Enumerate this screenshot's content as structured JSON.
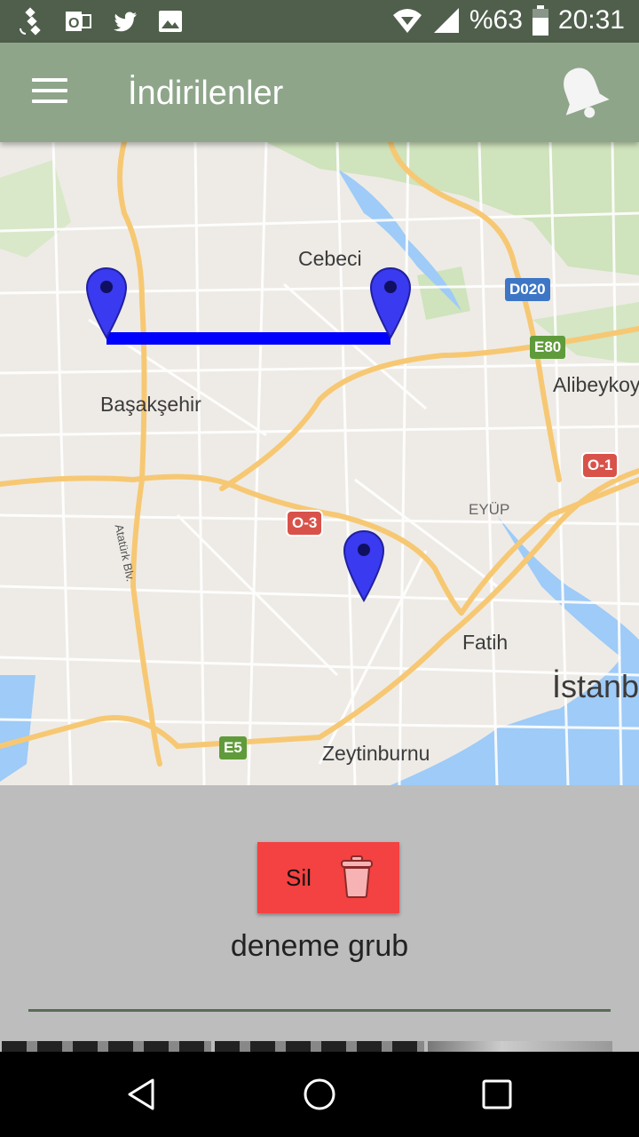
{
  "status_bar": {
    "battery": "%63",
    "time": "20:31",
    "icons": [
      "satellite-icon",
      "outlook-icon",
      "twitter-icon",
      "gallery-icon",
      "wifi-icon",
      "signal-icon",
      "battery-icon"
    ]
  },
  "app_bar": {
    "title": "İndirilenler",
    "menu_icon": "hamburger-menu-icon",
    "bell_icon": "bell-icon"
  },
  "map": {
    "labels": {
      "cebeci": "Cebeci",
      "basaksehir": "Başakşehir",
      "alibeykoy": "Alibeykoy",
      "eyup": "EYÜP",
      "fatih": "Fatih",
      "istanbul": "İstanb",
      "zeytinburnu": "Zeytinburnu",
      "ataturk": "Atatürk Blv."
    },
    "shields": {
      "d020": "D020",
      "e80": "E80",
      "o1": "O-1",
      "o3": "O-3",
      "e5": "E5"
    },
    "colors": {
      "route_line": "#0000ff",
      "marker": "#3a3af0",
      "water": "#9ecbf7",
      "park": "#c8e0b4",
      "highway": "#f7c873"
    }
  },
  "panel": {
    "delete_label": "Sil",
    "group_name": "deneme grub",
    "delete_color": "#f44141"
  },
  "nav_bar": {
    "icons": [
      "back-icon",
      "home-icon",
      "recents-icon"
    ]
  }
}
